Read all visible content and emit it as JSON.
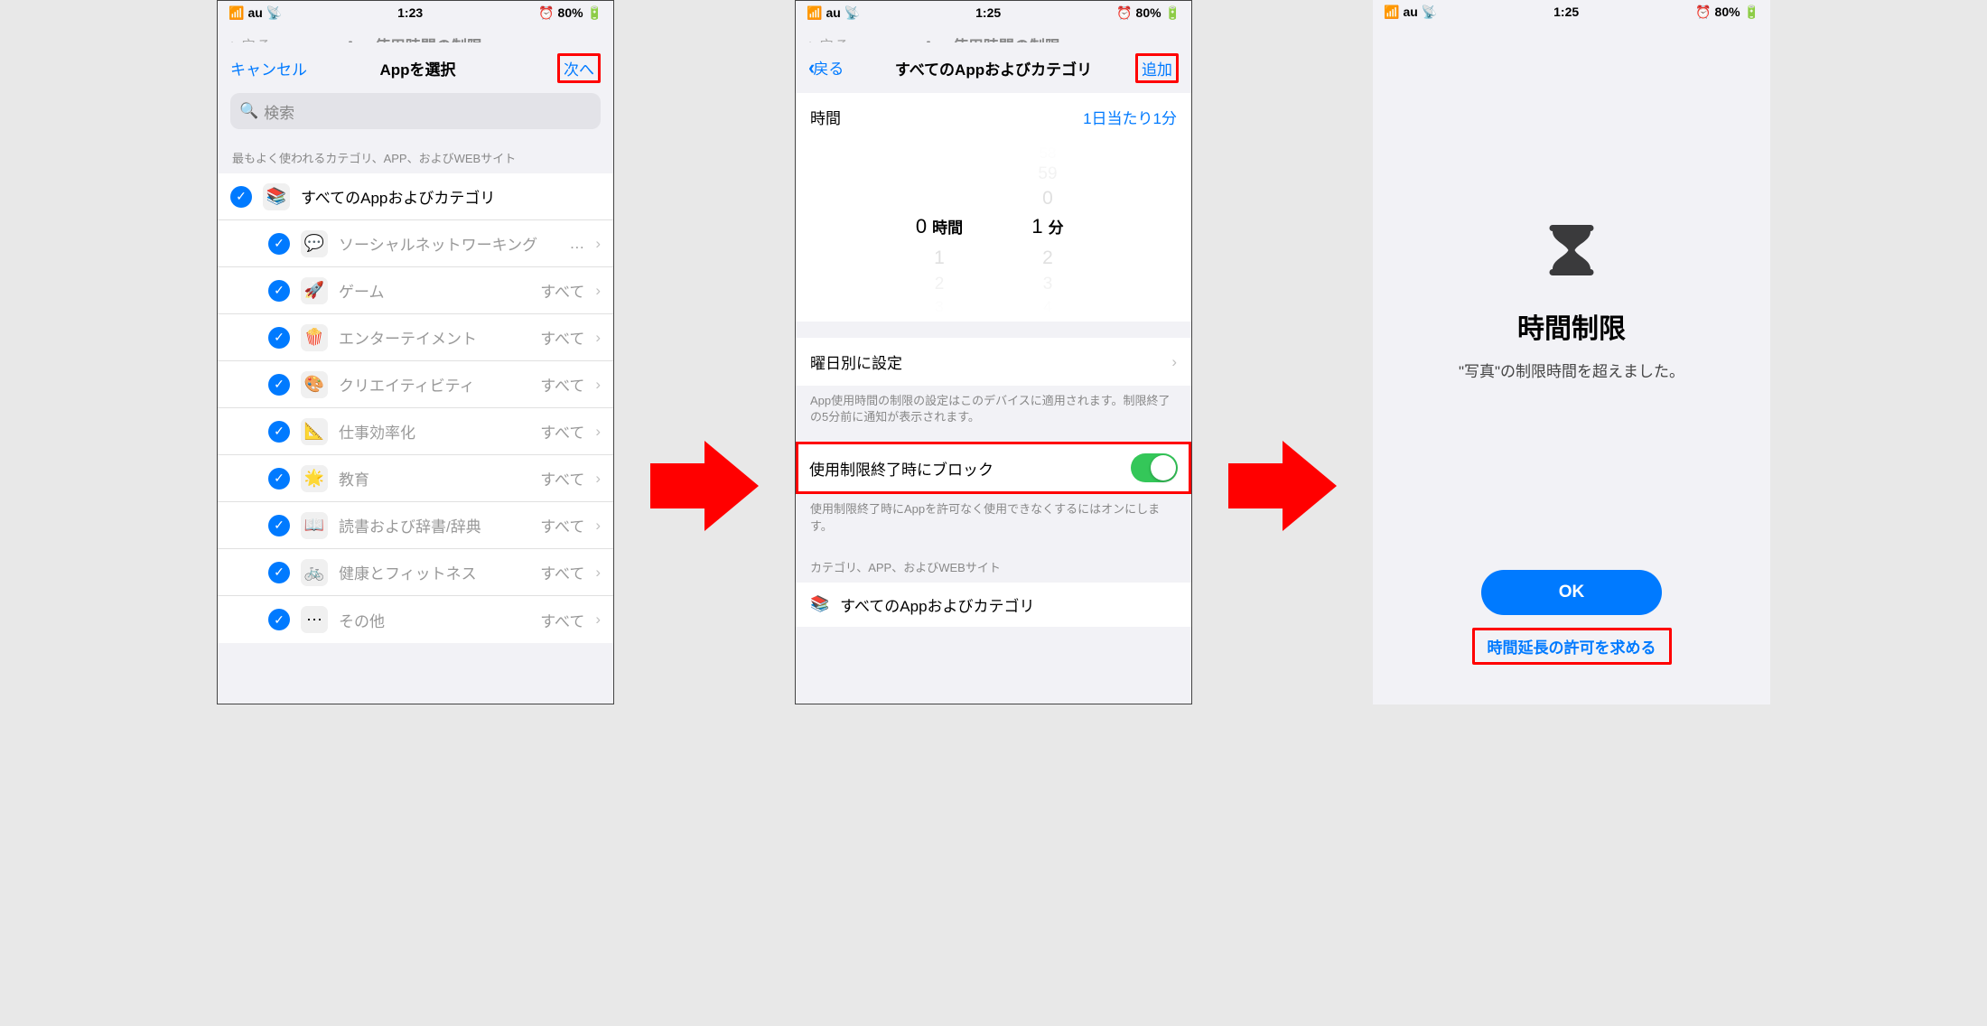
{
  "status": {
    "carrier": "au",
    "time1": "1:23",
    "time2": "1:25",
    "time3": "1:25",
    "battery": "80%",
    "alarm": "⏰"
  },
  "underlying_nav": {
    "back": "戻る",
    "title": "App使用時間の制限"
  },
  "screen1": {
    "cancel": "キャンセル",
    "title": "Appを選択",
    "next": "次へ",
    "search_placeholder": "検索",
    "section_header": "最もよく使われるカテゴリ、APP、およびWEBサイト",
    "categories": [
      {
        "icon": "📚",
        "label": "すべてのAppおよびカテゴリ",
        "detail": "",
        "gray": false
      },
      {
        "icon": "💬",
        "label": "ソーシャルネットワーキング",
        "detail": "…",
        "gray": true
      },
      {
        "icon": "🚀",
        "label": "ゲーム",
        "detail": "すべて",
        "gray": true
      },
      {
        "icon": "🍿",
        "label": "エンターテイメント",
        "detail": "すべて",
        "gray": true
      },
      {
        "icon": "🎨",
        "label": "クリエイティビティ",
        "detail": "すべて",
        "gray": true
      },
      {
        "icon": "📐",
        "label": "仕事効率化",
        "detail": "すべて",
        "gray": true
      },
      {
        "icon": "🌟",
        "label": "教育",
        "detail": "すべて",
        "gray": true
      },
      {
        "icon": "📖",
        "label": "読書および辞書/辞典",
        "detail": "すべて",
        "gray": true
      },
      {
        "icon": "🚲",
        "label": "健康とフィットネス",
        "detail": "すべて",
        "gray": true
      },
      {
        "icon": "⋯",
        "label": "その他",
        "detail": "すべて",
        "gray": true
      }
    ]
  },
  "screen2": {
    "back": "戻る",
    "title": "すべてのAppおよびカテゴリ",
    "add": "追加",
    "time_label": "時間",
    "time_value": "1日当たり1分",
    "picker": {
      "hours_label": "時間",
      "minutes_label": "分",
      "hours_sel": "0",
      "minutes_sel": "1",
      "min_fade_up": [
        "0",
        "59",
        "58"
      ],
      "hr_fade_down": [
        "1",
        "2",
        "3"
      ],
      "min_fade_down": [
        "2",
        "3",
        "4"
      ]
    },
    "by_day": "曜日別に設定",
    "footer1": "App使用時間の制限の設定はこのデバイスに適用されます。制限終了の5分前に通知が表示されます。",
    "block_label": "使用制限終了時にブロック",
    "footer2": "使用制限終了時にAppを許可なく使用できなくするにはオンにします。",
    "section_header2": "カテゴリ、APP、およびWEBサイト",
    "all_apps": "すべてのAppおよびカテゴリ"
  },
  "screen3": {
    "title": "時間制限",
    "subtitle": "\"写真\"の制限時間を超えました。",
    "ok": "OK",
    "request": "時間延長の許可を求める"
  }
}
